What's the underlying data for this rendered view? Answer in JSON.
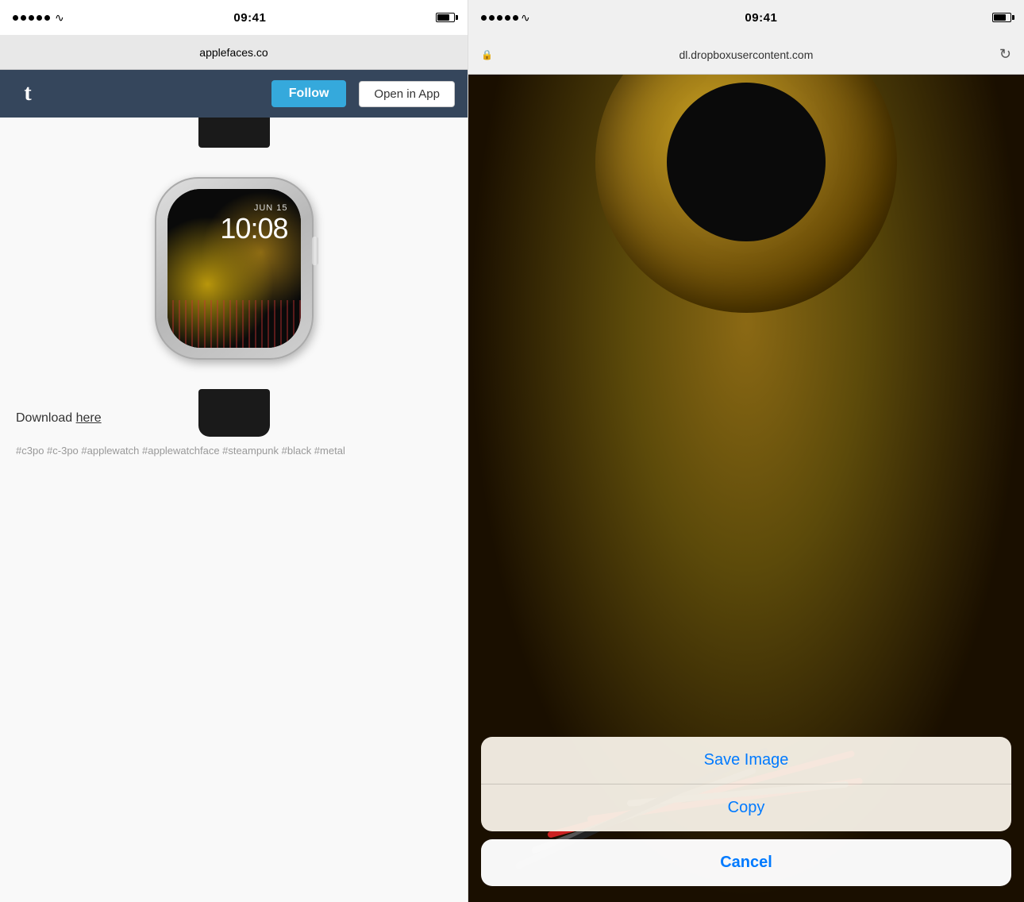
{
  "left": {
    "statusBar": {
      "time": "09:41",
      "url": "applefaces.co"
    },
    "header": {
      "followLabel": "Follow",
      "openInAppLabel": "Open in App"
    },
    "watchFace": {
      "date": "JUN 15",
      "time": "10:08"
    },
    "download": {
      "text": "Download ",
      "linkText": "here"
    },
    "tags": {
      "text": "#c3po  #c-3po  #applewatch\n#applewatchface  #steampunk  #black\n#metal"
    }
  },
  "right": {
    "statusBar": {
      "time": "09:41"
    },
    "urlBar": {
      "url": "dl.dropboxusercontent.com"
    },
    "actionSheet": {
      "saveImageLabel": "Save Image",
      "copyLabel": "Copy",
      "cancelLabel": "Cancel"
    }
  }
}
